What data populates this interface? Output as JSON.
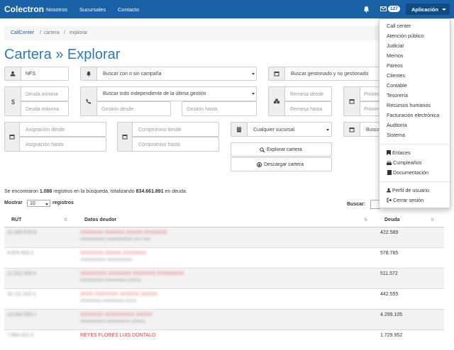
{
  "nav": {
    "brand": "Colectron",
    "links": [
      "Nosotros",
      "Sucursales",
      "Contacto"
    ],
    "badge": "127",
    "app": "Aplicación"
  },
  "breadcrumb": {
    "root": "CallCenter",
    "sep": "/",
    "items": [
      "cartera",
      "explorar"
    ]
  },
  "title": "Cartera » Explorar",
  "filters": {
    "nfs": "NFS",
    "campaign": "Buscar con o sin campaña",
    "managed": "Buscar gestionado y no gestionado",
    "debt_min": "Deuda mínima",
    "debt_max": "Deuda máxima",
    "last_mgmt": "Buscar todo independiente de la última gestión",
    "mgmt_from": "Gestión desde",
    "mgmt_to": "Gestión hasta",
    "remesa_from": "Remesa desde",
    "remesa_to": "Remesa hasta",
    "next_from": "Próxim",
    "next_to": "Próxim",
    "assign_from": "Asignación desde",
    "assign_to": "Asignación hasta",
    "commit_from": "Compromiso desde",
    "commit_to": "Compromiso hasta",
    "branch": "Cualquier sucursal",
    "busca": "Busca"
  },
  "buttons": {
    "explore": "Explorar cartera",
    "download": "Descargar cartera"
  },
  "summary": {
    "pre": "Se encontraron ",
    "count": "1.088",
    "mid": " registros en la búsqueda, totalizando ",
    "total": "834.661.891",
    "post": " en deuda."
  },
  "table_controls": {
    "show": "Mostrar",
    "length": "10",
    "records": "registros",
    "search": "Buscar:"
  },
  "table": {
    "headers": [
      "RUT",
      "Datos deudor",
      "Deuda"
    ],
    "rows": [
      {
        "debt": "422.589"
      },
      {
        "debt": "578.785"
      },
      {
        "debt": "511.572"
      },
      {
        "debt": "442.555"
      },
      {
        "debt": "4.299.105"
      },
      {
        "name": "REYES FLORES LUIS DONTALO",
        "debt": "1.729.952"
      }
    ]
  },
  "menu": {
    "items": [
      "Call center",
      "Atención público",
      "Judicial",
      "Memos",
      "Pareos",
      "Clientes",
      "Contable",
      "Tesorería",
      "Recursos humanos",
      "Facturación electrónica",
      "Auditoría",
      "Sistema"
    ],
    "links": [
      "Enlaces",
      "Cumpleaños",
      "Documentación"
    ],
    "user": [
      "Perfil de usuario",
      "Cerrar sesión"
    ]
  }
}
